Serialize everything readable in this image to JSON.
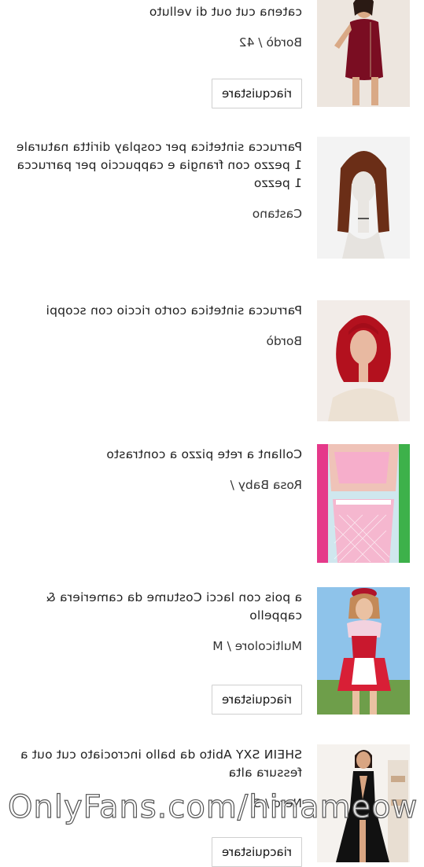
{
  "items": [
    {
      "title": "catena cut out di velluto",
      "variant": "Bordò / 42",
      "button": "riacquistare"
    },
    {
      "title": "Parrucca sintetica per cosplay diritta naturale 1 pezzo con frangia e cappuccio per parrucca 1 pezzo",
      "variant": "Castano"
    },
    {
      "title": "Parrucca sintetica corto riccio con scoppi",
      "variant": "Bordò"
    },
    {
      "title": "Collant a rete pizzo a contrasto",
      "variant": "Rosa Baby /"
    },
    {
      "title": "a pois con lacci Costume da cameriera & cappello",
      "variant": "Multicolore / M",
      "button": "riacquistare"
    },
    {
      "title": "SHEIN SXY Abito da ballo incrociato cut out a fessura alta",
      "variant": "Nero / S",
      "button": "riacquistare"
    }
  ],
  "watermark": "OnlyFans.com/hinameow"
}
